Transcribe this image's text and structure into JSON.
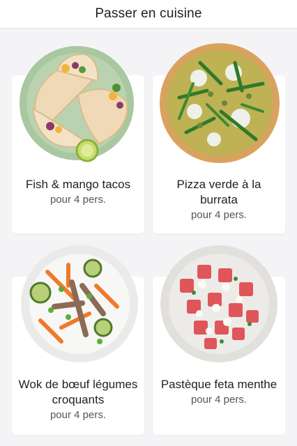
{
  "header": {
    "title": "Passer en cuisine"
  },
  "recipes": [
    {
      "title": "Fish & mango tacos",
      "servings": "pour 4 pers.",
      "image_icon": "tacos-plate-image"
    },
    {
      "title": "Pizza verde à la burrata",
      "servings": "pour 4 pers.",
      "image_icon": "pizza-verde-image"
    },
    {
      "title": "Wok de bœuf légumes croquants",
      "servings": "pour 4 pers.",
      "image_icon": "beef-wok-bowl-image"
    },
    {
      "title": "Pastèque feta menthe",
      "servings": "pour 4 pers.",
      "image_icon": "watermelon-feta-bowl-image"
    }
  ],
  "colors": {
    "background": "#f4f4f6",
    "card": "#ffffff",
    "header": "#ffffff"
  }
}
